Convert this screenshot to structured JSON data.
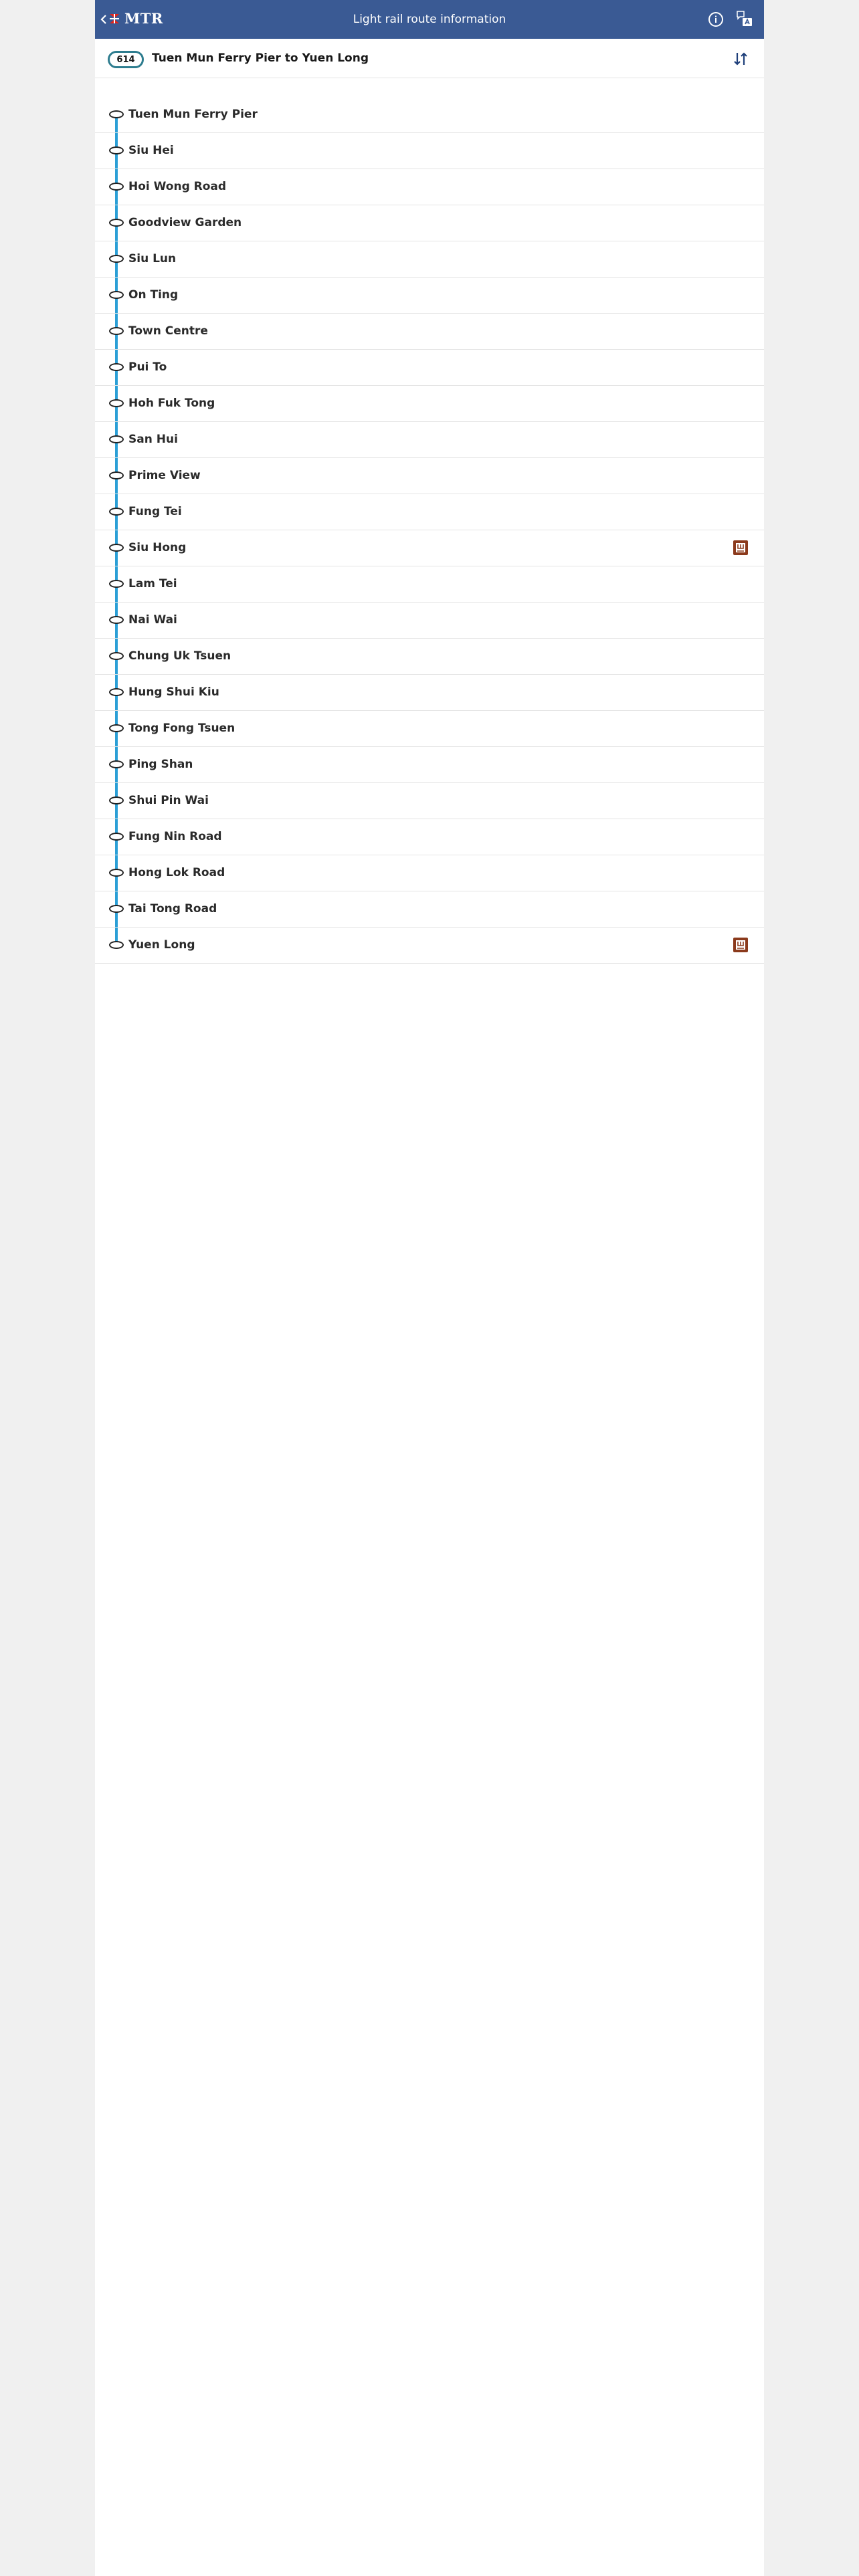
{
  "header": {
    "brand": "MTR",
    "title": "Light rail route information",
    "brand_color": "#3a5a94"
  },
  "route": {
    "number": "614",
    "title": "Tuen Mun Ferry Pier to Yuen Long"
  },
  "stops": [
    {
      "name": "Tuen Mun Ferry Pier"
    },
    {
      "name": "Siu Hei"
    },
    {
      "name": "Hoi Wong Road"
    },
    {
      "name": "Goodview Garden"
    },
    {
      "name": "Siu Lun"
    },
    {
      "name": "On Ting"
    },
    {
      "name": "Town Centre"
    },
    {
      "name": "Pui To"
    },
    {
      "name": "Hoh Fuk Tong"
    },
    {
      "name": "San Hui"
    },
    {
      "name": "Prime View"
    },
    {
      "name": "Fung Tei"
    },
    {
      "name": "Siu Hong",
      "icon": "mtr-station-icon"
    },
    {
      "name": "Lam Tei"
    },
    {
      "name": "Nai Wai"
    },
    {
      "name": "Chung Uk Tsuen"
    },
    {
      "name": "Hung Shui Kiu"
    },
    {
      "name": "Tong Fong Tsuen"
    },
    {
      "name": "Ping Shan"
    },
    {
      "name": "Shui Pin Wai"
    },
    {
      "name": "Fung Nin Road"
    },
    {
      "name": "Hong Lok Road"
    },
    {
      "name": "Tai Tong Road"
    },
    {
      "name": "Yuen Long",
      "icon": "mtr-station-icon"
    }
  ]
}
